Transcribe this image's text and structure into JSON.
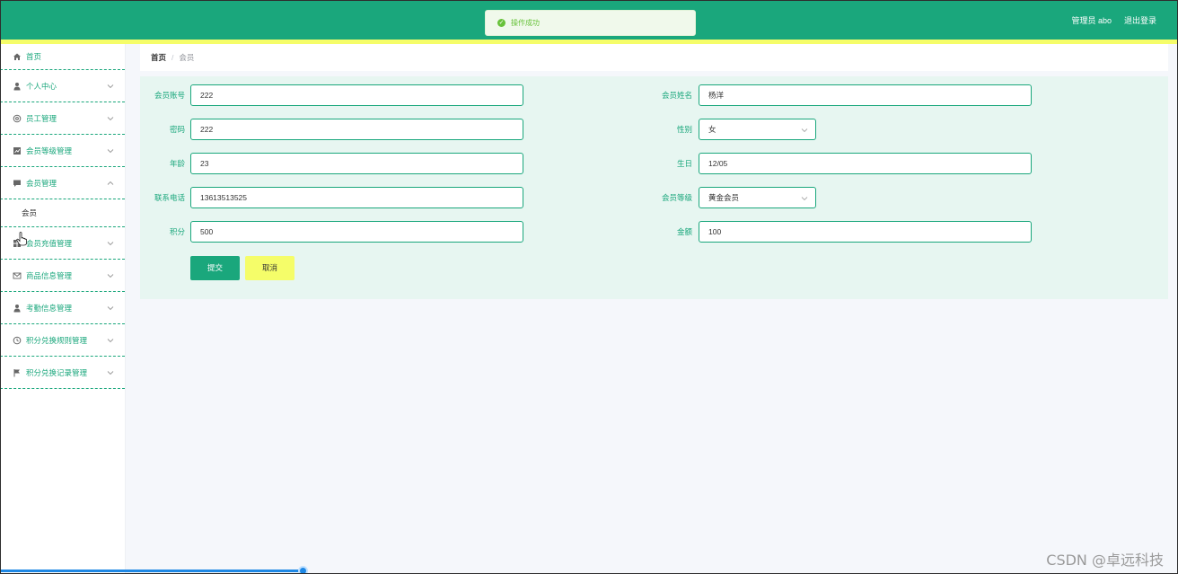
{
  "header": {
    "admin_label": "管理员 abo",
    "logout_label": "退出登录",
    "bg_color": "#1aa77c",
    "accent_color": "#f5fd69"
  },
  "toast": {
    "icon": "check-circle-icon",
    "message": "操作成功"
  },
  "sidebar": {
    "items": [
      {
        "label": "首页",
        "icon": "home-icon"
      },
      {
        "label": "个人中心",
        "icon": "user-icon"
      },
      {
        "label": "员工管理",
        "icon": "settings-icon"
      },
      {
        "label": "会员等级管理",
        "icon": "chart-icon"
      },
      {
        "label": "会员管理",
        "icon": "message-icon",
        "expanded": true,
        "children": [
          {
            "label": "会员"
          }
        ]
      },
      {
        "label": "会员充值管理",
        "icon": "grid-icon"
      },
      {
        "label": "商品信息管理",
        "icon": "mail-icon"
      },
      {
        "label": "考勤信息管理",
        "icon": "user-icon"
      },
      {
        "label": "积分兑换规则管理",
        "icon": "clock-icon"
      },
      {
        "label": "积分兑换记录管理",
        "icon": "flag-icon"
      }
    ]
  },
  "breadcrumb": {
    "home": "首页",
    "separator": "/",
    "current": "会员"
  },
  "form": {
    "account_label": "会员账号",
    "account_value": "222",
    "name_label": "会员姓名",
    "name_value": "杨洋",
    "password_label": "密码",
    "password_value": "222",
    "gender_label": "性别",
    "gender_value": "女",
    "age_label": "年龄",
    "age_value": "23",
    "birthday_label": "生日",
    "birthday_value": "12/05",
    "phone_label": "联系电话",
    "phone_value": "13613513525",
    "level_label": "会员等级",
    "level_value": "黄金会员",
    "points_label": "积分",
    "points_value": "500",
    "amount_label": "金额",
    "amount_value": "100",
    "submit_label": "提交",
    "cancel_label": "取消"
  },
  "watermark": "CSDN @卓远科技"
}
